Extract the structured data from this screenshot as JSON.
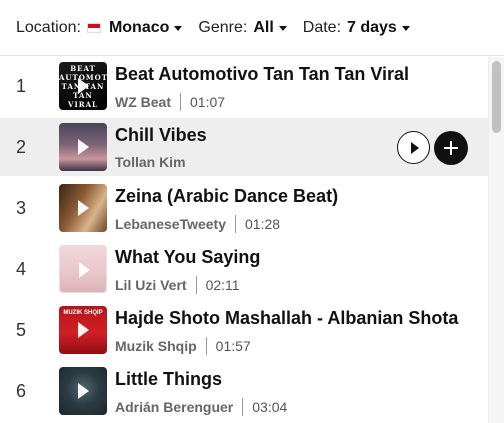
{
  "filters": {
    "location": {
      "label": "Location:",
      "value": "Monaco"
    },
    "genre": {
      "label": "Genre:",
      "value": "All"
    },
    "date": {
      "label": "Date:",
      "value": "7 days"
    }
  },
  "tracks": [
    {
      "rank": "1",
      "title": "Beat Automotivo Tan Tan Tan Viral",
      "artist": "WZ Beat",
      "duration": "01:07",
      "cover_text": "BEAT AUTOMOTIVO TAN TAN TAN VIRAL"
    },
    {
      "rank": "2",
      "title": "Chill Vibes",
      "artist": "Tollan Kim",
      "duration": ""
    },
    {
      "rank": "3",
      "title": "Zeina (Arabic Dance Beat)",
      "artist": "LebaneseTweety",
      "duration": "01:28"
    },
    {
      "rank": "4",
      "title": "What You Saying",
      "artist": "Lil Uzi Vert",
      "duration": "02:11"
    },
    {
      "rank": "5",
      "title": "Hajde Shoto Mashallah - Albanian Shota",
      "artist": "Muzik Shqip",
      "duration": "01:57",
      "cover_text": "MUZIK SHQIP"
    },
    {
      "rank": "6",
      "title": "Little Things",
      "artist": "Adrián Berenguer",
      "duration": "03:04"
    }
  ],
  "colors": {
    "hover_row": "#eeeeee",
    "text": "#111111",
    "secondary": "#666666"
  }
}
